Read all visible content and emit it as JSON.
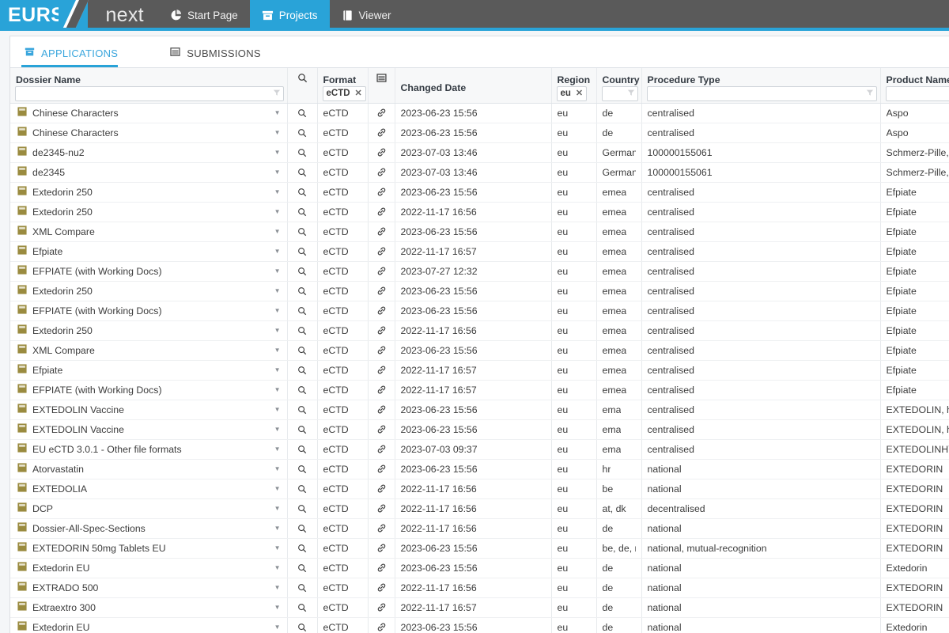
{
  "app": {
    "logo_primary": "EURS",
    "logo_secondary": "next",
    "accent_color": "#29a3d8",
    "bar_color": "#5a5a5a",
    "nav": [
      {
        "label": "Start Page",
        "icon": "pie-chart-icon",
        "active": false
      },
      {
        "label": "Projects",
        "icon": "archive-box-icon",
        "active": true
      },
      {
        "label": "Viewer",
        "icon": "book-icon",
        "active": false
      }
    ]
  },
  "tabs": [
    {
      "label": "APPLICATIONS",
      "icon": "archive-box-icon",
      "active": true
    },
    {
      "label": "SUBMISSIONS",
      "icon": "table-icon",
      "active": false
    }
  ],
  "grid": {
    "columns": [
      {
        "key": "dossier_name",
        "label": "Dossier Name",
        "filter_type": "text",
        "filter_value": "",
        "sort": null
      },
      {
        "key": "search",
        "label": "",
        "icon": "search-icon",
        "filter_type": "none"
      },
      {
        "key": "format",
        "label": "Format",
        "filter_type": "chip",
        "filter_value": "eCTD"
      },
      {
        "key": "link",
        "label": "",
        "icon": "table-icon",
        "filter_type": "none"
      },
      {
        "key": "changed_date",
        "label": "Changed Date",
        "filter_type": "none"
      },
      {
        "key": "region",
        "label": "Region",
        "filter_type": "chip",
        "filter_value": "eu"
      },
      {
        "key": "country",
        "label": "Country",
        "filter_type": "text",
        "filter_value": ""
      },
      {
        "key": "procedure_type",
        "label": "Procedure Type",
        "filter_type": "text",
        "filter_value": ""
      },
      {
        "key": "product_name",
        "label": "Product Name",
        "filter_type": "text",
        "filter_value": "",
        "sort": "asc"
      }
    ],
    "row_icon": "dossier-folder-icon",
    "row_caret": "chevron-down-icon",
    "row_search_icon": "search-icon",
    "row_link_icon": "link-icon",
    "rows": [
      {
        "dossier_name": "Chinese Characters",
        "format": "eCTD",
        "changed_date": "2023-06-23 15:56",
        "region": "eu",
        "country": "de",
        "procedure_type": "centralised",
        "product_name": "Aspo"
      },
      {
        "dossier_name": "Chinese Characters",
        "format": "eCTD",
        "changed_date": "2023-06-23 15:56",
        "region": "eu",
        "country": "de",
        "procedure_type": "centralised",
        "product_name": "Aspo"
      },
      {
        "dossier_name": "de2345-nu2",
        "format": "eCTD",
        "changed_date": "2023-07-03 13:46",
        "region": "eu",
        "country": "Germany",
        "procedure_type": "100000155061",
        "product_name": "Schmerz-Pille, Douleur-Pilule"
      },
      {
        "dossier_name": "de2345",
        "format": "eCTD",
        "changed_date": "2023-07-03 13:46",
        "region": "eu",
        "country": "Germany",
        "procedure_type": "100000155061",
        "product_name": "Schmerz-Pille, Douleur-Pilule"
      },
      {
        "dossier_name": "Extedorin 250",
        "format": "eCTD",
        "changed_date": "2023-06-23 15:56",
        "region": "eu",
        "country": "emea",
        "procedure_type": "centralised",
        "product_name": "Efpiate"
      },
      {
        "dossier_name": "Extedorin 250",
        "format": "eCTD",
        "changed_date": "2022-11-17 16:56",
        "region": "eu",
        "country": "emea",
        "procedure_type": "centralised",
        "product_name": "Efpiate"
      },
      {
        "dossier_name": "XML Compare",
        "format": "eCTD",
        "changed_date": "2023-06-23 15:56",
        "region": "eu",
        "country": "emea",
        "procedure_type": "centralised",
        "product_name": "Efpiate"
      },
      {
        "dossier_name": "Efpiate",
        "format": "eCTD",
        "changed_date": "2022-11-17 16:57",
        "region": "eu",
        "country": "emea",
        "procedure_type": "centralised",
        "product_name": "Efpiate"
      },
      {
        "dossier_name": "EFPIATE (with Working Docs)",
        "format": "eCTD",
        "changed_date": "2023-07-27 12:32",
        "region": "eu",
        "country": "emea",
        "procedure_type": "centralised",
        "product_name": "Efpiate"
      },
      {
        "dossier_name": "Extedorin 250",
        "format": "eCTD",
        "changed_date": "2023-06-23 15:56",
        "region": "eu",
        "country": "emea",
        "procedure_type": "centralised",
        "product_name": "Efpiate"
      },
      {
        "dossier_name": "EFPIATE (with Working Docs)",
        "format": "eCTD",
        "changed_date": "2023-06-23 15:56",
        "region": "eu",
        "country": "emea",
        "procedure_type": "centralised",
        "product_name": "Efpiate"
      },
      {
        "dossier_name": "Extedorin 250",
        "format": "eCTD",
        "changed_date": "2022-11-17 16:56",
        "region": "eu",
        "country": "emea",
        "procedure_type": "centralised",
        "product_name": "Efpiate"
      },
      {
        "dossier_name": "XML Compare",
        "format": "eCTD",
        "changed_date": "2023-06-23 15:56",
        "region": "eu",
        "country": "emea",
        "procedure_type": "centralised",
        "product_name": "Efpiate"
      },
      {
        "dossier_name": "Efpiate",
        "format": "eCTD",
        "changed_date": "2022-11-17 16:57",
        "region": "eu",
        "country": "emea",
        "procedure_type": "centralised",
        "product_name": "Efpiate"
      },
      {
        "dossier_name": "EFPIATE (with Working Docs)",
        "format": "eCTD",
        "changed_date": "2022-11-17 16:57",
        "region": "eu",
        "country": "emea",
        "procedure_type": "centralised",
        "product_name": "Efpiate"
      },
      {
        "dossier_name": "EXTEDOLIN Vaccine",
        "format": "eCTD",
        "changed_date": "2023-06-23 15:56",
        "region": "eu",
        "country": "ema",
        "procedure_type": "centralised",
        "product_name": "EXTEDOLIN, human influenza"
      },
      {
        "dossier_name": "EXTEDOLIN Vaccine",
        "format": "eCTD",
        "changed_date": "2023-06-23 15:56",
        "region": "eu",
        "country": "ema",
        "procedure_type": "centralised",
        "product_name": "EXTEDOLIN, human influenza"
      },
      {
        "dossier_name": "EU eCTD 3.0.1 - Other file formats",
        "format": "eCTD",
        "changed_date": "2023-07-03 09:37",
        "region": "eu",
        "country": "ema",
        "procedure_type": "centralised",
        "product_name": "EXTEDOLINHYDROCHLORIDE"
      },
      {
        "dossier_name": "Atorvastatin",
        "format": "eCTD",
        "changed_date": "2023-06-23 15:56",
        "region": "eu",
        "country": "hr",
        "procedure_type": "national",
        "product_name": "EXTEDORIN"
      },
      {
        "dossier_name": "EXTEDOLIA",
        "format": "eCTD",
        "changed_date": "2022-11-17 16:56",
        "region": "eu",
        "country": "be",
        "procedure_type": "national",
        "product_name": "EXTEDORIN"
      },
      {
        "dossier_name": "DCP",
        "format": "eCTD",
        "changed_date": "2022-11-17 16:56",
        "region": "eu",
        "country": "at, dk",
        "procedure_type": "decentralised",
        "product_name": "EXTEDORIN"
      },
      {
        "dossier_name": "Dossier-All-Spec-Sections",
        "format": "eCTD",
        "changed_date": "2022-11-17 16:56",
        "region": "eu",
        "country": "de",
        "procedure_type": "national",
        "product_name": "EXTEDORIN"
      },
      {
        "dossier_name": "EXTEDORIN 50mg Tablets EU",
        "format": "eCTD",
        "changed_date": "2023-06-23 15:56",
        "region": "eu",
        "country": "be, de, nl",
        "procedure_type": "national, mutual-recognition",
        "product_name": "EXTEDORIN"
      },
      {
        "dossier_name": "Extedorin EU",
        "format": "eCTD",
        "changed_date": "2023-06-23 15:56",
        "region": "eu",
        "country": "de",
        "procedure_type": "national",
        "product_name": "Extedorin"
      },
      {
        "dossier_name": "EXTRADO 500",
        "format": "eCTD",
        "changed_date": "2022-11-17 16:56",
        "region": "eu",
        "country": "de",
        "procedure_type": "national",
        "product_name": "EXTEDORIN"
      },
      {
        "dossier_name": "Extraextro 300",
        "format": "eCTD",
        "changed_date": "2022-11-17 16:57",
        "region": "eu",
        "country": "de",
        "procedure_type": "national",
        "product_name": "EXTEDORIN"
      },
      {
        "dossier_name": "Extedorin EU",
        "format": "eCTD",
        "changed_date": "2023-06-23 15:56",
        "region": "eu",
        "country": "de",
        "procedure_type": "national",
        "product_name": "Extedorin"
      }
    ]
  }
}
